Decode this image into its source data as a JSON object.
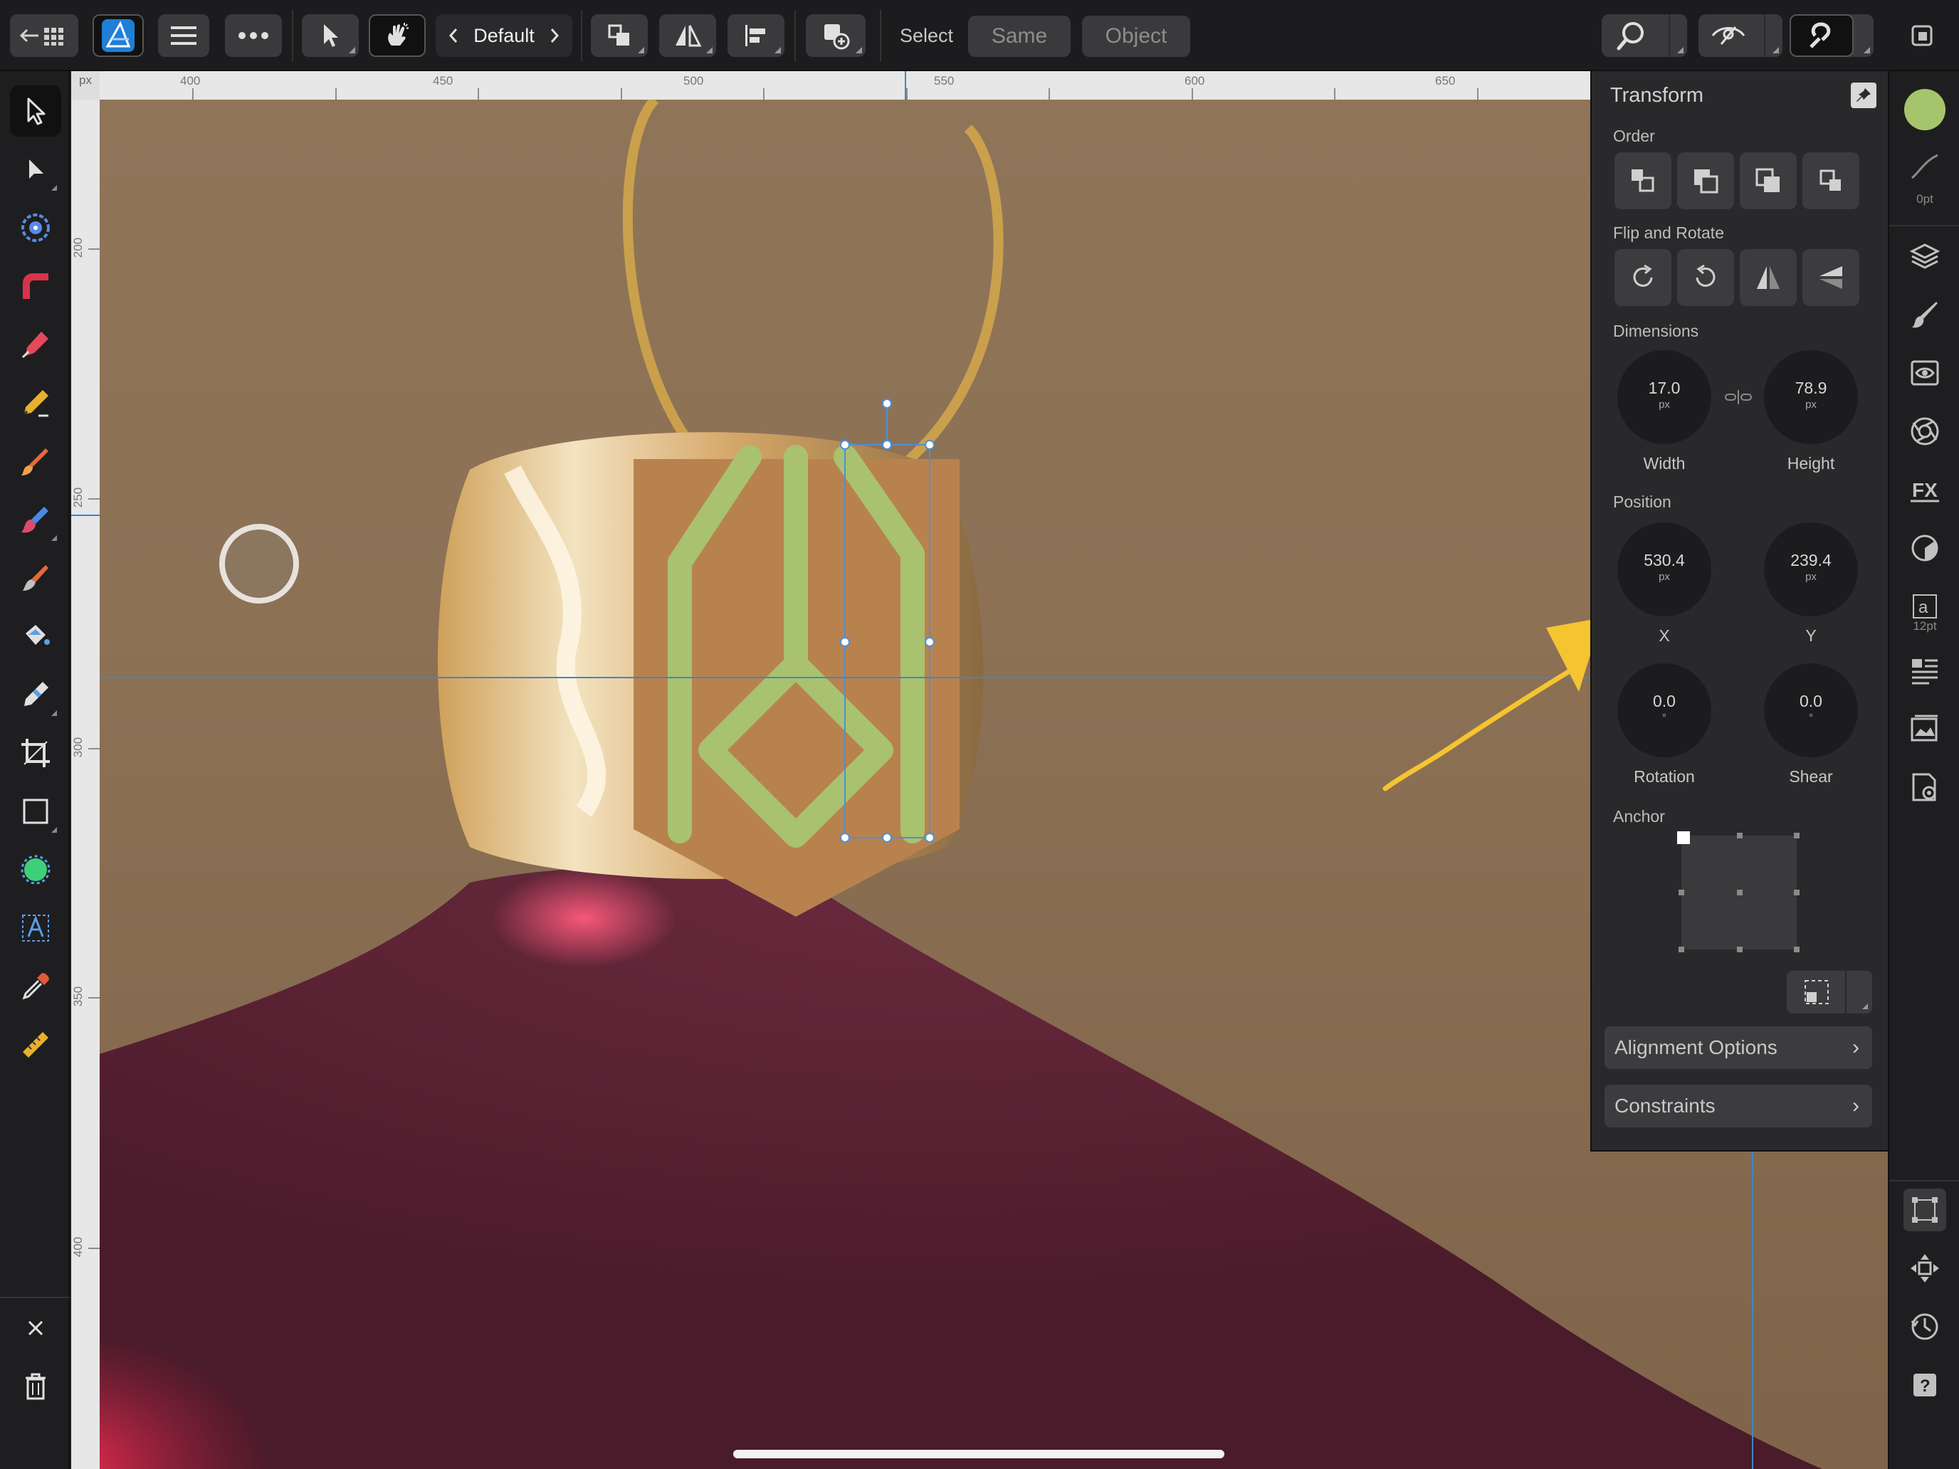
{
  "toolbar": {
    "persona": "Default",
    "select_label": "Select",
    "same_label": "Same",
    "object_label": "Object"
  },
  "ruler": {
    "unit": "px",
    "top_labels": [
      "400",
      "450",
      "500",
      "550",
      "600",
      "650"
    ],
    "left_labels": [
      "200",
      "250",
      "300",
      "350",
      "400"
    ]
  },
  "panel": {
    "title": "Transform",
    "order_label": "Order",
    "flip_rotate_label": "Flip and Rotate",
    "dimensions_label": "Dimensions",
    "width_value": "17.0",
    "width_unit": "px",
    "width_label": "Width",
    "height_value": "78.9",
    "height_unit": "px",
    "height_label": "Height",
    "position_label": "Position",
    "x_value": "530.4",
    "x_unit": "px",
    "x_label": "X",
    "y_value": "239.4",
    "y_unit": "px",
    "y_label": "Y",
    "rotation_value": "0.0",
    "rotation_unit": "°",
    "rotation_label": "Rotation",
    "shear_value": "0.0",
    "shear_unit": "°",
    "shear_label": "Shear",
    "anchor_label": "Anchor",
    "alignment_options": "Alignment Options",
    "constraints": "Constraints"
  },
  "studio": {
    "stroke_width": "0pt",
    "text_size": "12pt"
  },
  "colors": {
    "fill_swatch": "#a6c46c",
    "tag_fill": "#b8824f",
    "tag_stroke": "#a9c26f",
    "selection": "#4a90d9",
    "annotation_arrow": "#f5c431"
  },
  "icons": {
    "back": "back-grid-icon",
    "app": "affinity-designer-icon",
    "menu": "hamburger-menu-icon",
    "more": "more-icon",
    "move_tool": "move-tool-icon",
    "gesture": "hand-gesture-icon"
  }
}
